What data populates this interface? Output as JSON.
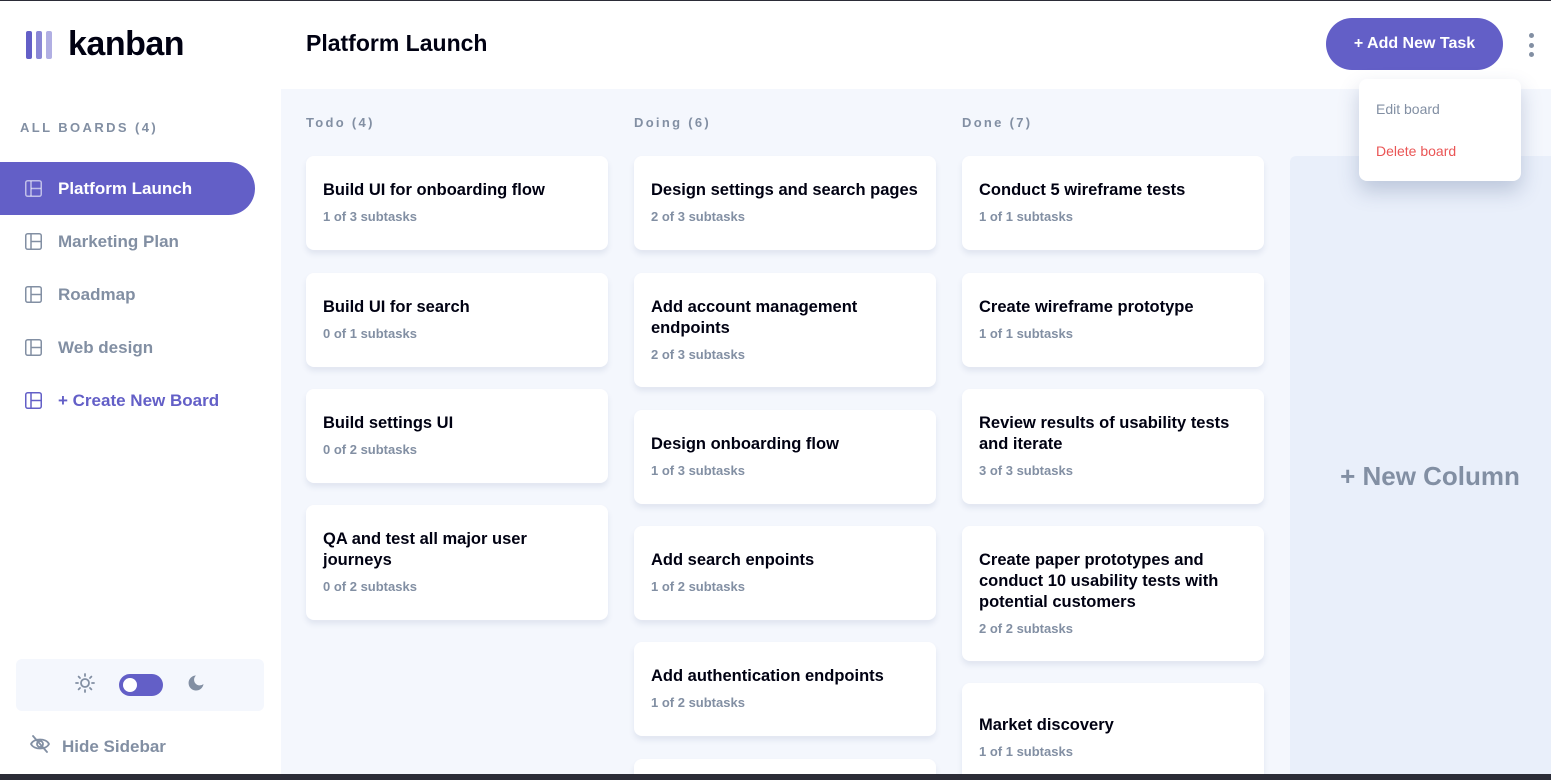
{
  "app": {
    "logo_text": "kanban"
  },
  "sidebar": {
    "heading": "ALL BOARDS (4)",
    "boards": [
      {
        "label": "Platform Launch",
        "active": true
      },
      {
        "label": "Marketing Plan",
        "active": false
      },
      {
        "label": "Roadmap",
        "active": false
      },
      {
        "label": "Web design",
        "active": false
      }
    ],
    "create_label": "+ Create New Board",
    "theme": {
      "mode": "dark-toggle",
      "light_icon": "sun-icon",
      "dark_icon": "moon-icon"
    },
    "hide_label": "Hide Sidebar"
  },
  "header": {
    "title": "Platform Launch",
    "add_task_label": "+ Add New Task"
  },
  "menu": {
    "edit_label": "Edit board",
    "delete_label": "Delete board"
  },
  "columns": [
    {
      "title": "Todo (4)",
      "tasks": [
        {
          "title": "Build UI for onboarding flow",
          "subtasks": "1 of 3 subtasks"
        },
        {
          "title": "Build UI for search",
          "subtasks": "0 of 1 subtasks"
        },
        {
          "title": "Build settings UI",
          "subtasks": "0 of 2 subtasks"
        },
        {
          "title": "QA and test all major user journeys",
          "subtasks": "0 of 2 subtasks"
        }
      ]
    },
    {
      "title": "Doing (6)",
      "tasks": [
        {
          "title": "Design settings and search pages",
          "subtasks": "2 of 3 subtasks"
        },
        {
          "title": "Add account management endpoints",
          "subtasks": "2 of 3 subtasks"
        },
        {
          "title": "Design onboarding flow",
          "subtasks": "1 of 3 subtasks"
        },
        {
          "title": "Add search enpoints",
          "subtasks": "1 of 2 subtasks"
        },
        {
          "title": "Add authentication endpoints",
          "subtasks": "1 of 2 subtasks"
        }
      ]
    },
    {
      "title": "Done (7)",
      "tasks": [
        {
          "title": "Conduct 5 wireframe tests",
          "subtasks": "1 of 1 subtasks"
        },
        {
          "title": "Create wireframe prototype",
          "subtasks": "1 of 1 subtasks"
        },
        {
          "title": "Review results of usability tests and iterate",
          "subtasks": "3 of 3 subtasks"
        },
        {
          "title": "Create paper prototypes and conduct 10 usability tests with potential customers",
          "subtasks": "2 of 2 subtasks"
        },
        {
          "title": "Market discovery",
          "subtasks": "1 of 1 subtasks"
        }
      ]
    }
  ],
  "new_column_label": "+ New Column",
  "colors": {
    "accent": "#635fc7",
    "board_bg": "#f4f7fd",
    "muted_text": "#828fa3",
    "danger": "#ea5555"
  }
}
